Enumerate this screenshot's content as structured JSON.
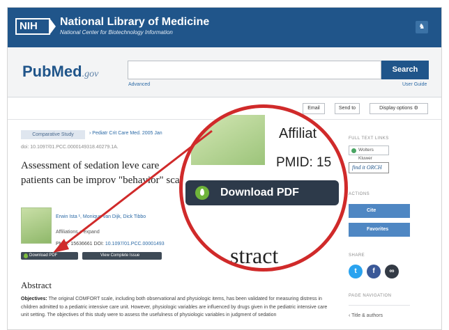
{
  "header": {
    "logo": "NIH",
    "title": "National Library of Medicine",
    "subtitle": "National Center for Biotechnology Information",
    "user_icon": "user-icon"
  },
  "search": {
    "logo_main": "PubMed",
    "logo_suffix": ".gov",
    "button": "Search",
    "advanced": "Advanced",
    "user_guide": "User Guide",
    "value": ""
  },
  "toolbar": {
    "email": "Email",
    "send_to": "Send to",
    "display_options": "Display options"
  },
  "article": {
    "badge": "Comparative Study",
    "journal": "› Pediatr Crit Care Med. 2005 Jan",
    "doi": "doi: 10.1097/01.PCC.0000149318.40279.1A.",
    "title": "Assessment of sedation leve care patients can be improv \"behavior\" scale",
    "authors": "Erwin Ista ¹, Monique van Dijk, Dick Tibbo",
    "affiliations": "Affiliations  + expand",
    "pmid": "PMID: 15636661   DOI: ",
    "doi_link": "10.1097/01.PCC.00001493",
    "download_small": "Download PDF",
    "view_issue": "View Complete Issue",
    "abstract_heading": "Abstract",
    "abstract_label": "Objectives:",
    "abstract_text": " The original COMFORT scale, including both observational and physiologic items, has been validated for measuring distress in children admitted to a pediatric intensive care unit. However, physiologic variables are influenced by drugs given in the pediatric intensive care unit setting. The objectives of this study were to assess the usefulness of physiologic variables in judgment of sedation"
  },
  "rail": {
    "full_text_links": "FULL TEXT LINKS",
    "wolters": "Wolters Kluwer",
    "findit": "find it ORCH",
    "actions": "ACTIONS",
    "cite": "Cite",
    "favorites": "Favorites",
    "share": "SHARE",
    "page_nav": "PAGE NAVIGATION",
    "title_authors": "Title & authors"
  },
  "zoom": {
    "affil": "Affiliat",
    "pmid": "PMID: 15",
    "download": "Download PDF",
    "abstract": "stract"
  },
  "colors": {
    "nih_blue": "#20558a",
    "button_blue": "#4f87c3",
    "callout_red": "#d02a2a",
    "dark_button": "#2d3a4a",
    "pdf_green": "#6fb43a"
  }
}
